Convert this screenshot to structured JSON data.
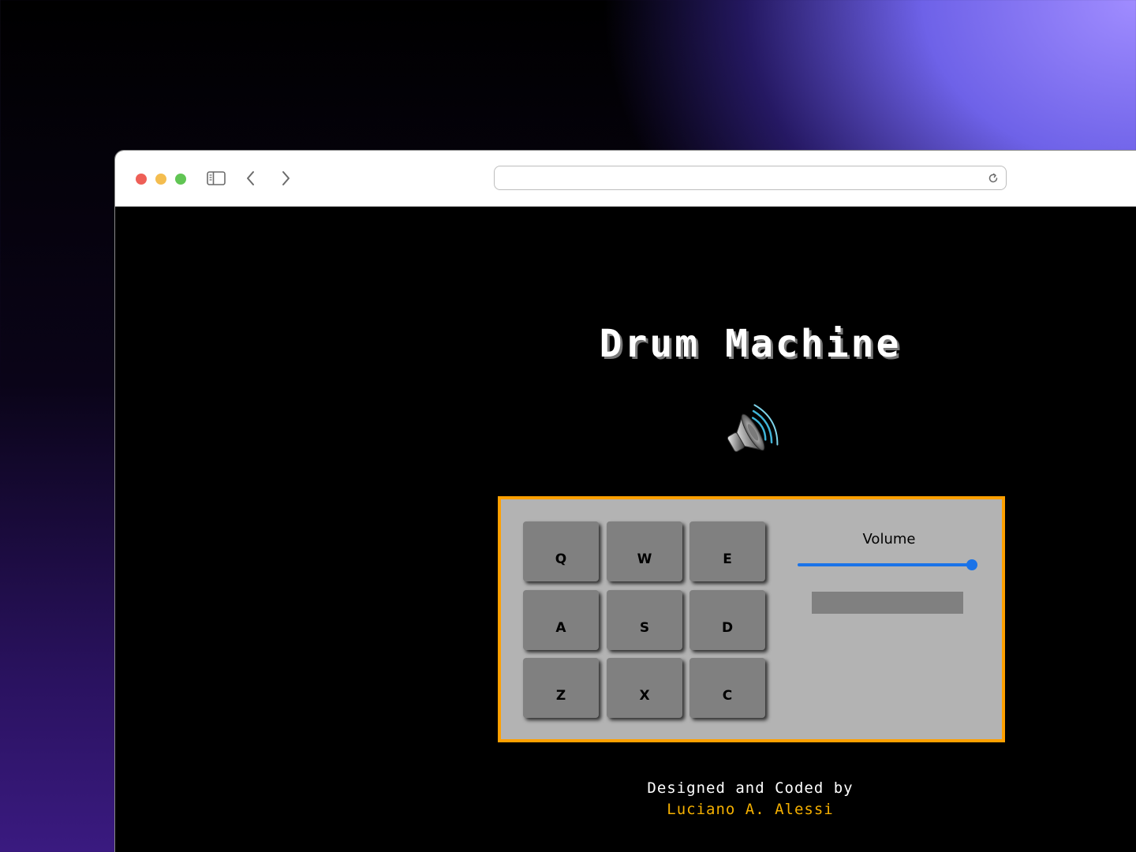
{
  "browser": {
    "url": ""
  },
  "app": {
    "title": "Drum Machine",
    "speaker_icon": "speaker-high-volume-icon"
  },
  "drum_machine": {
    "pads": [
      "Q",
      "W",
      "E",
      "A",
      "S",
      "D",
      "Z",
      "X",
      "C"
    ],
    "volume_label": "Volume",
    "volume": 1.0,
    "display_text": ""
  },
  "footer": {
    "credit": "Designed and Coded by",
    "author": "Luciano A. Alessi"
  },
  "colors": {
    "machine_border": "#ffa000",
    "machine_bg": "#b3b3b3",
    "pad_bg": "#808080",
    "slider_accent": "#1a73e8",
    "author_text": "#f5b000"
  }
}
